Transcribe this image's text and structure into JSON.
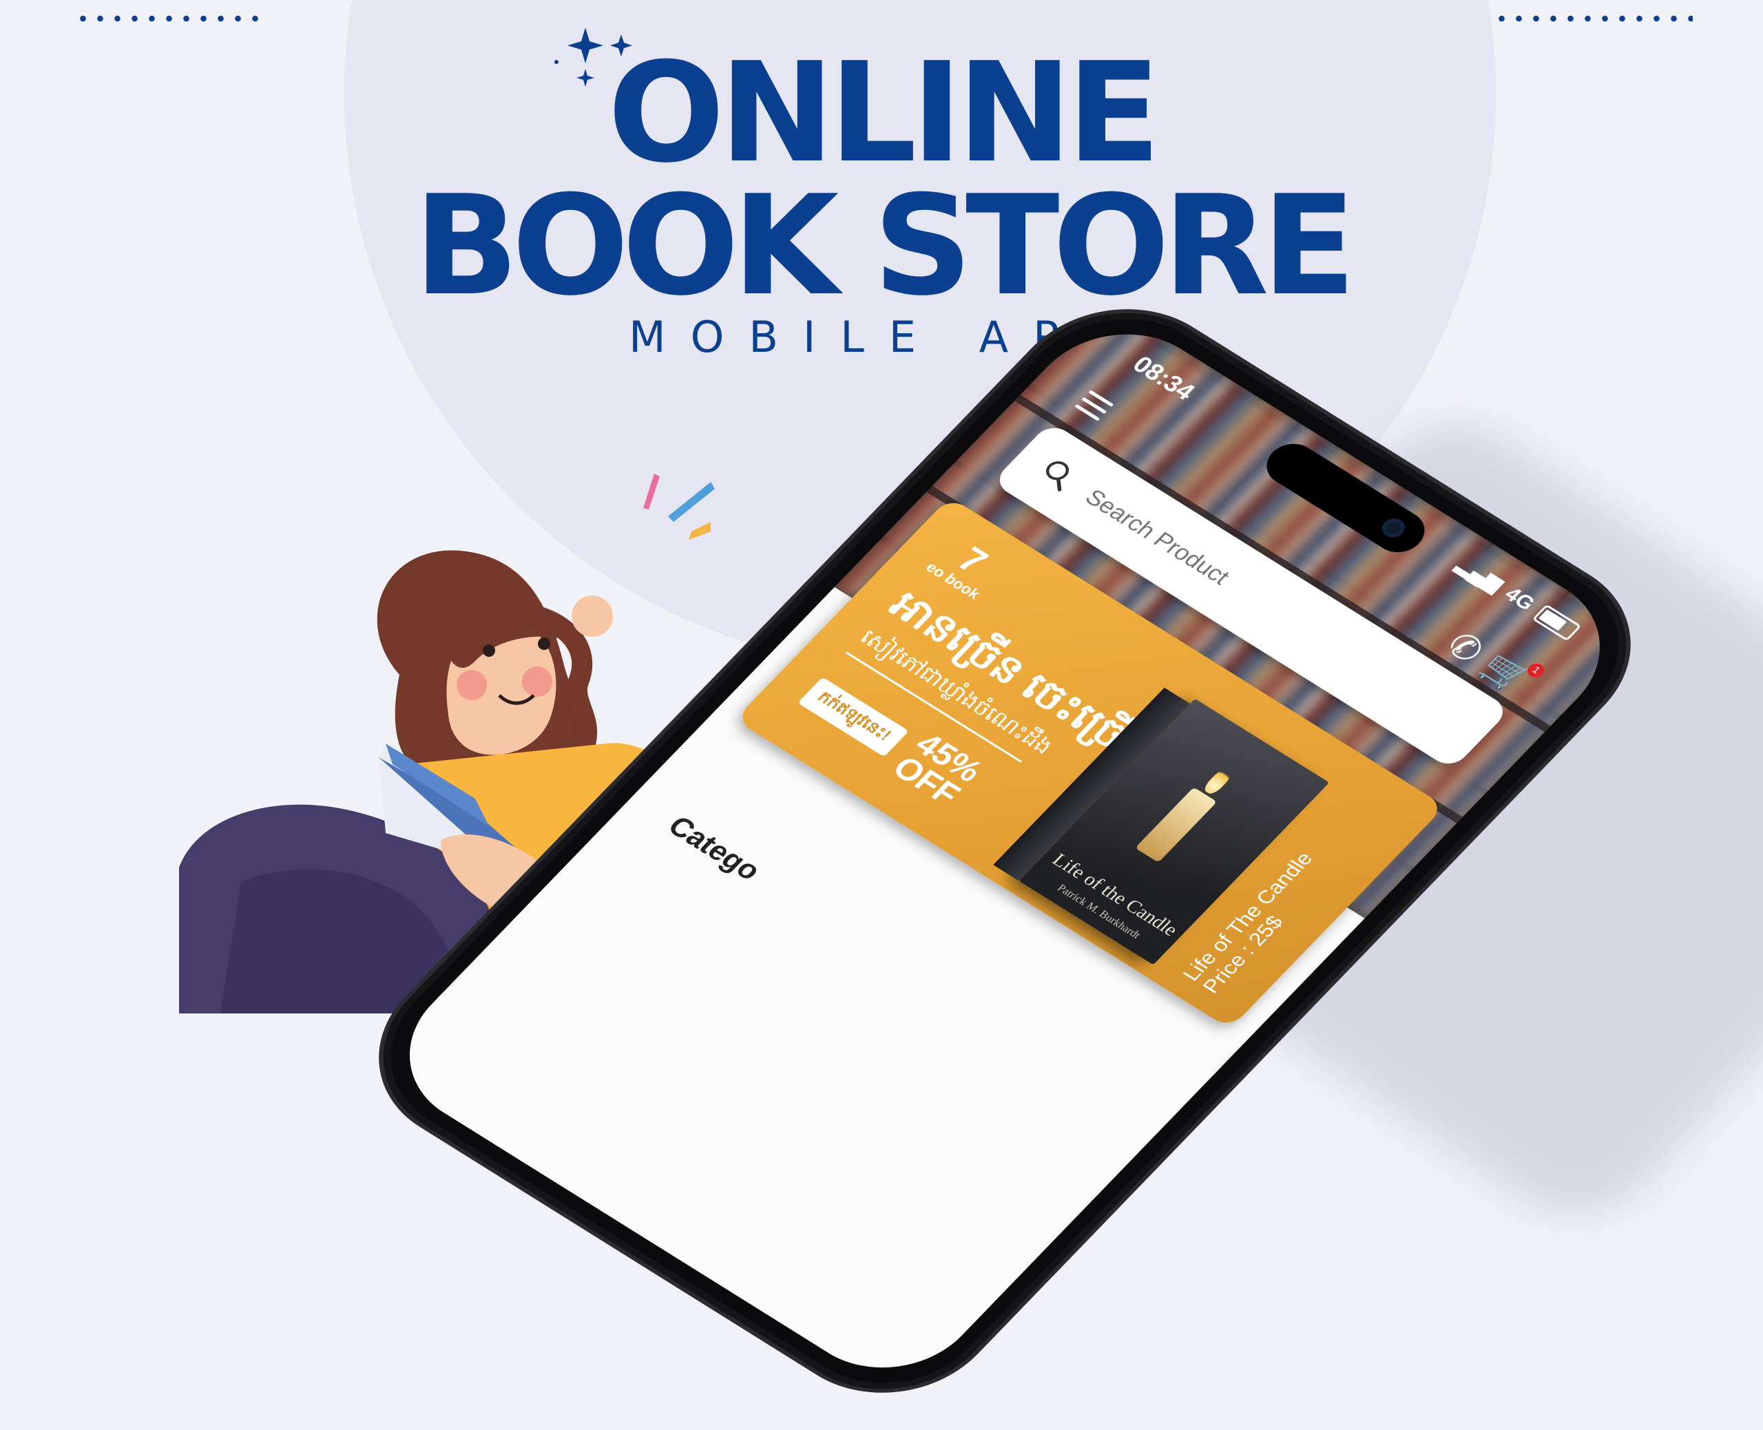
{
  "headline": {
    "line1": "ONLINE",
    "line2": "BOOK STORE",
    "subtitle": "MOBILE APP"
  },
  "colors": {
    "brand_blue": "#0b3f8f",
    "background": "#f1f1f8",
    "circle": "#e5e6f2",
    "banner_orange": "#e7a235"
  },
  "phone": {
    "status_bar": {
      "time": "08:34",
      "network": "4G"
    },
    "header": {
      "icons": [
        "menu-icon",
        "phone-icon",
        "cart-icon"
      ],
      "cart_count": "1"
    },
    "search": {
      "placeholder": "Search Product"
    },
    "banner": {
      "logo_text": "eo book",
      "title_km": "អានច្រើន ចេះច្រើន",
      "subtitle_km": "សៀវភៅជាឃ្លាំងចំណេះដឹង",
      "tag_km": "កក់ឥឡូវនេះ!",
      "discount_percent": "45%",
      "discount_label": "OFF",
      "book_title": "Life of the Candle",
      "book_author": "Patrick M. Burkhardt",
      "side_title": "Life of The Candle",
      "side_price": "Price : 25$"
    },
    "section_label": "Catego"
  }
}
